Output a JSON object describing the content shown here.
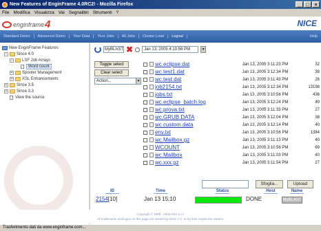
{
  "window": {
    "title": "New Features of EnginFrame 4.0RC2! - Mozilla Firefox"
  },
  "menu": [
    "File",
    "Modifica",
    "Visualizza",
    "Vai",
    "Segnalibri",
    "Strumenti",
    "?"
  ],
  "brand": {
    "logo_text": "enginframe",
    "logo_version": "4",
    "right_logo": "NICE"
  },
  "nav": {
    "items": [
      "Standard Demo",
      "Advanced Demo",
      "Your Data",
      "Your Jobs",
      "All Jobs",
      "Cluster Load"
    ],
    "logout": "Logout",
    "help": "Help"
  },
  "sidebar": {
    "root": "New EnginFrame Features",
    "items": [
      {
        "label": "Since 4.0",
        "level": 1,
        "kind": "folder",
        "expander": "−"
      },
      {
        "label": "LSF Job Arrays",
        "level": 2,
        "kind": "folder",
        "expander": "−"
      },
      {
        "label": "Word count",
        "level": 3,
        "kind": "page",
        "selected": true
      },
      {
        "label": "Spooler Management",
        "level": 2,
        "kind": "folder",
        "expander": "+"
      },
      {
        "label": "XSL Enhancements",
        "level": 2,
        "kind": "folder",
        "expander": "+"
      },
      {
        "label": "Since 3.5",
        "level": 1,
        "kind": "folder",
        "expander": "+"
      },
      {
        "label": "Since 3.3",
        "level": 1,
        "kind": "folder",
        "expander": "+"
      },
      {
        "label": "View the source",
        "level": 1,
        "kind": "page"
      }
    ]
  },
  "spooler": {
    "name": "MyBLAST",
    "date": "Jan 13, 2005 4:10:56 PM"
  },
  "buttons": {
    "toggle": "Toggle select",
    "clear": "Clear select",
    "action": "Action...",
    "browse": "Sfoglia...",
    "upload": "Upload"
  },
  "files": [
    {
      "name": "wc.eclipse.dat",
      "date": "Jan 13, 2005 3:11:23 PM",
      "size": "32"
    },
    {
      "name": "wc.test1.dat",
      "date": "Jan 13, 2005 3:12:34 PM",
      "size": "38"
    },
    {
      "name": "wc.test.dat",
      "date": "Jan 13, 2005 3:11:43 PM",
      "size": "26"
    },
    {
      "name": "job2154.txt",
      "date": "Jan 13, 2005 3:12:34 PM",
      "size": "13198"
    },
    {
      "name": "jobs.txt",
      "date": "Jan 13, 2005 3:10:56 PM",
      "size": "436"
    },
    {
      "name": "wc.eclipse_batch.log",
      "date": "Jan 13, 2005 3:12:24 PM",
      "size": "49"
    },
    {
      "name": "wc.prova.txt",
      "date": "Jan 13, 2005 3:11:33 PM",
      "size": "27"
    },
    {
      "name": "wc.GRUB.DATA",
      "date": "Jan 13, 2005 3:12:04 PM",
      "size": "38"
    },
    {
      "name": "wc.custom.data",
      "date": "Jan 13, 2005 3:12:14 PM",
      "size": "40"
    },
    {
      "name": "env.txt",
      "date": "Jan 13, 2005 3:10:56 PM",
      "size": "1384"
    },
    {
      "name": "wc.Mailbox.gz",
      "date": "Jan 13, 2005 3:11:13 PM",
      "size": "40"
    },
    {
      "name": "WCOUNT",
      "date": "Jan 13, 2005 3:10:56 PM",
      "size": "69"
    },
    {
      "name": "wc.Mailbox",
      "date": "Jan 13, 2005 3:11:03 PM",
      "size": "40"
    },
    {
      "name": "wc.xxx.gz",
      "date": "Jan 13, 2005 3:11:54 PM",
      "size": "27"
    }
  ],
  "jobs": {
    "headers": {
      "id": "ID",
      "time": "Time",
      "status": "Status",
      "host": "Host",
      "name": "Name"
    },
    "row": {
      "id": "2154",
      "suffix": "[10]",
      "time": "Jan 13 15:10",
      "status": "DONE",
      "name": "MyBLAST",
      "progress": 1.0
    }
  },
  "footer": {
    "line1": "Copyright © 1998 - 2004 Nice S.r.l.",
    "line2": "All trademarks and logos on this page are owned by NICE s.r.l. or by their respective owners."
  },
  "statusbar": "Trasferimento dati da www.enginframe.com...",
  "colors": {
    "nav": "#2d5ca3",
    "progress": "#0be60b",
    "link": "#1a3eb8"
  }
}
